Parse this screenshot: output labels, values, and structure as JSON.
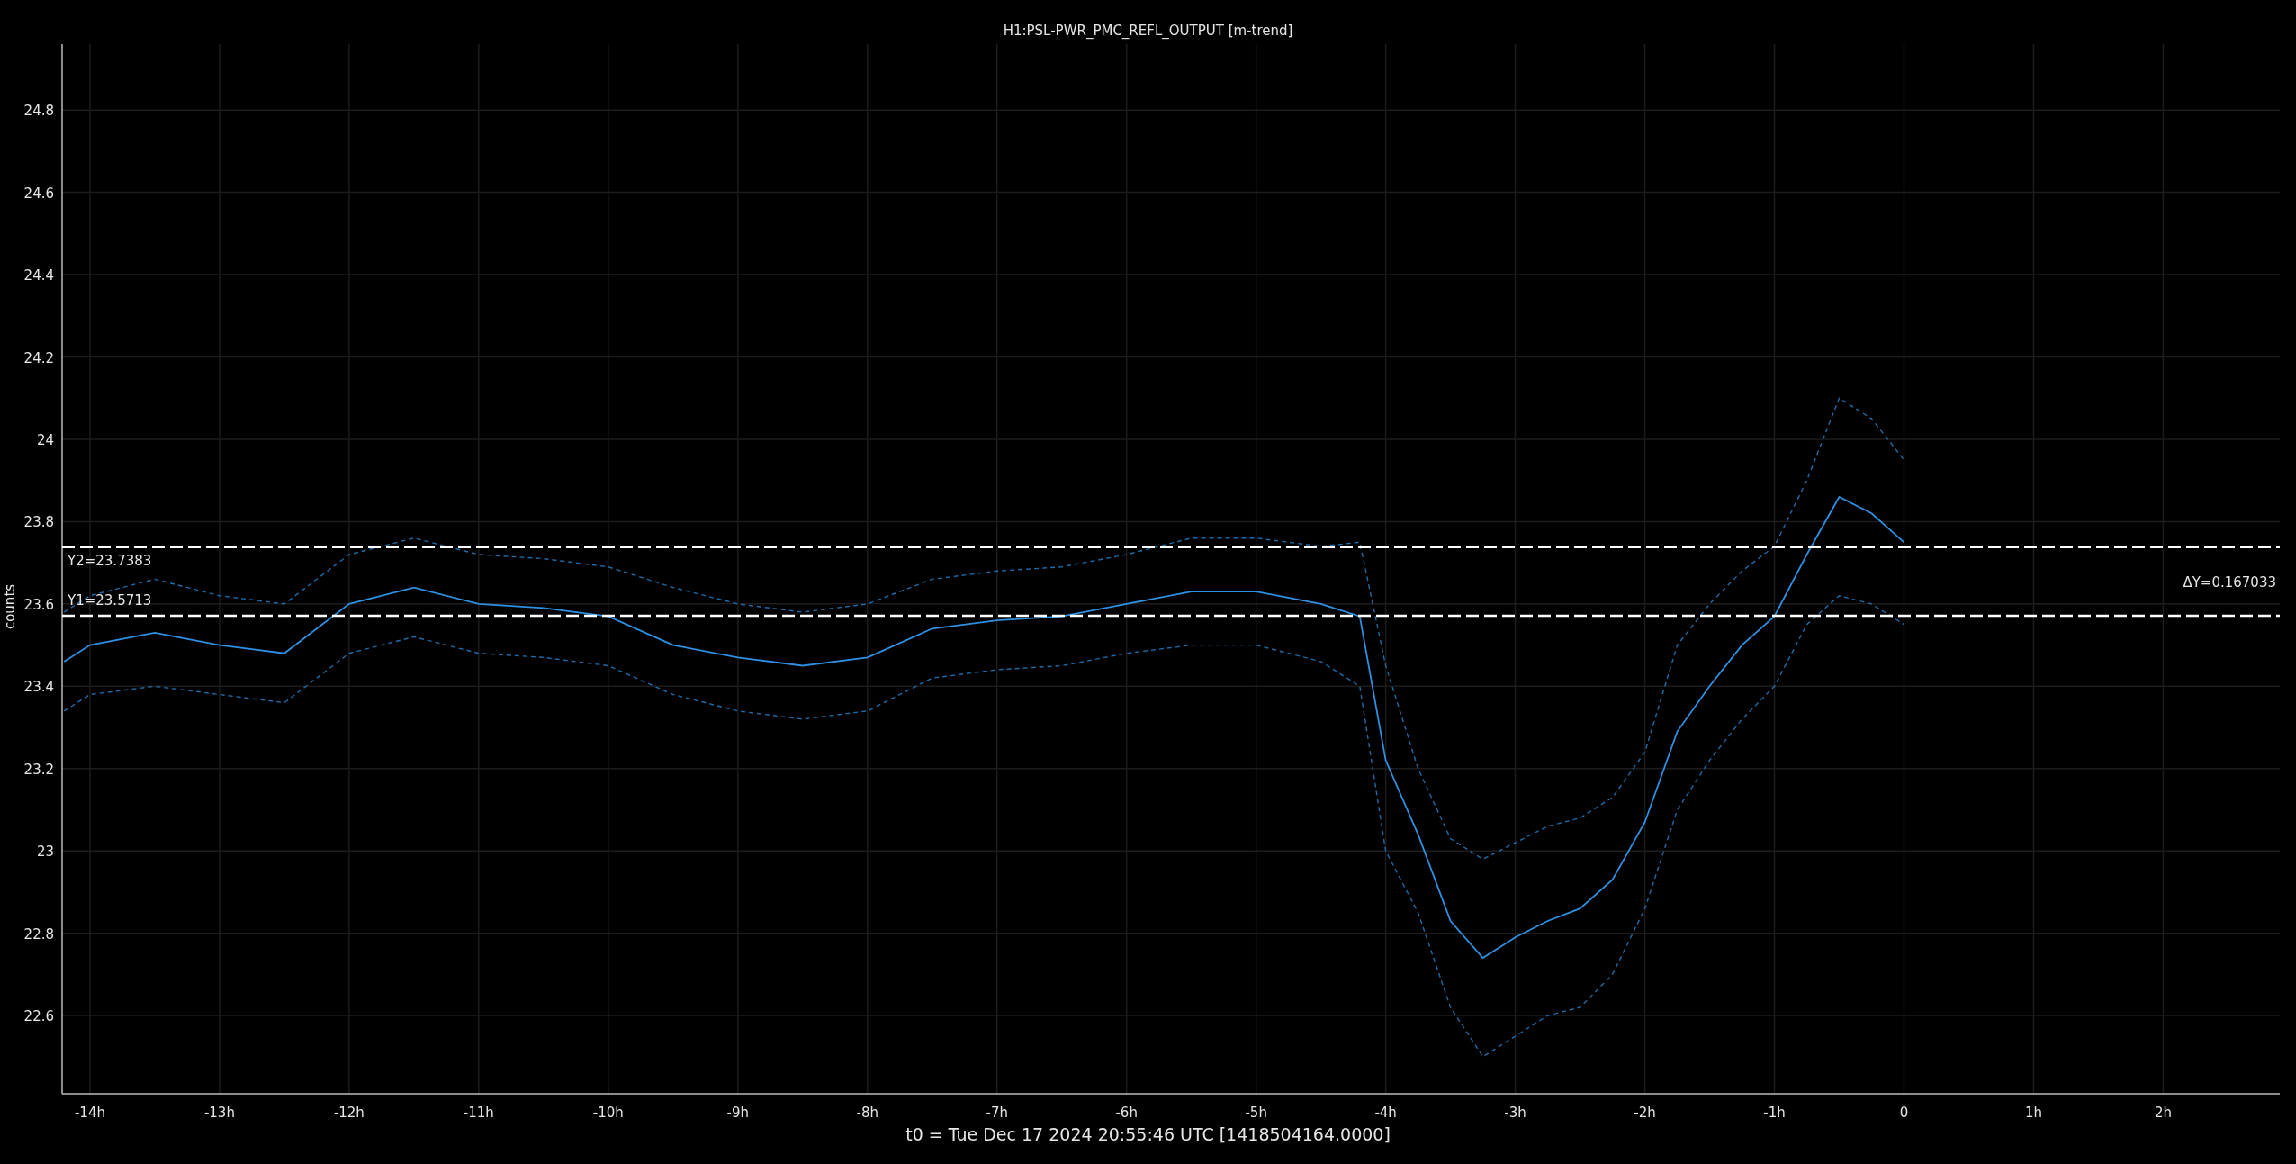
{
  "plot": {
    "title": "H1:PSL-PWR_PMC_REFL_OUTPUT [m-trend]",
    "chart_data": {
      "type": "line",
      "ylabel": "counts",
      "grid": true,
      "xlim": [
        -14.215,
        2.9
      ],
      "ylim": [
        22.41,
        24.96
      ],
      "xticks": [
        {
          "value": -14,
          "label": "-14h"
        },
        {
          "value": -13,
          "label": "-13h"
        },
        {
          "value": -12,
          "label": "-12h"
        },
        {
          "value": -11,
          "label": "-11h"
        },
        {
          "value": -10,
          "label": "-10h"
        },
        {
          "value": -9,
          "label": "-9h"
        },
        {
          "value": -8,
          "label": "-8h"
        },
        {
          "value": -7,
          "label": "-7h"
        },
        {
          "value": -6,
          "label": "-6h"
        },
        {
          "value": -5,
          "label": "-5h"
        },
        {
          "value": -4,
          "label": "-4h"
        },
        {
          "value": -3,
          "label": "-3h"
        },
        {
          "value": -2,
          "label": "-2h"
        },
        {
          "value": -1,
          "label": "-1h"
        },
        {
          "value": 0,
          "label": "0"
        },
        {
          "value": 1,
          "label": "1h"
        },
        {
          "value": 2,
          "label": "2h"
        }
      ],
      "yticks": [
        22.6,
        22.8,
        23,
        23.2,
        23.4,
        23.6,
        23.8,
        24,
        24.2,
        24.4,
        24.6,
        24.8
      ],
      "x": [
        -14.2,
        -14,
        -13.5,
        -13,
        -12.5,
        -12,
        -11.5,
        -11,
        -10.5,
        -10,
        -9.5,
        -9,
        -8.5,
        -8,
        -7.5,
        -7,
        -6.5,
        -6,
        -5.5,
        -5,
        -4.5,
        -4.2,
        -4,
        -3.75,
        -3.5,
        -3.25,
        -3,
        -2.75,
        -2.5,
        -2.25,
        -2,
        -1.75,
        -1.5,
        -1.25,
        -1,
        -0.75,
        -0.5,
        -0.25,
        0
      ],
      "series": [
        {
          "color": "#1f6aa8",
          "line_style": "dashed",
          "values": [
            23.58,
            23.62,
            23.66,
            23.62,
            23.6,
            23.72,
            23.76,
            23.72,
            23.71,
            23.69,
            23.64,
            23.6,
            23.58,
            23.6,
            23.66,
            23.68,
            23.69,
            23.72,
            23.76,
            23.76,
            23.74,
            23.75,
            23.45,
            23.2,
            23.03,
            22.98,
            23.02,
            23.06,
            23.08,
            23.13,
            23.24,
            23.5,
            23.6,
            23.68,
            23.74,
            23.9,
            24.1,
            24.05,
            23.95
          ]
        },
        {
          "color": "#1f6aa8",
          "line_style": "dashed",
          "values": [
            23.34,
            23.38,
            23.4,
            23.38,
            23.36,
            23.48,
            23.52,
            23.48,
            23.47,
            23.45,
            23.38,
            23.34,
            23.32,
            23.34,
            23.42,
            23.44,
            23.45,
            23.48,
            23.5,
            23.5,
            23.46,
            23.4,
            23.0,
            22.85,
            22.62,
            22.5,
            22.55,
            22.6,
            22.62,
            22.7,
            22.86,
            23.1,
            23.22,
            23.32,
            23.4,
            23.55,
            23.62,
            23.6,
            23.55
          ]
        },
        {
          "color": "#2f8fe0",
          "line_style": "solid",
          "values": [
            23.46,
            23.5,
            23.53,
            23.5,
            23.48,
            23.6,
            23.64,
            23.6,
            23.59,
            23.57,
            23.5,
            23.47,
            23.45,
            23.47,
            23.54,
            23.56,
            23.57,
            23.6,
            23.63,
            23.63,
            23.6,
            23.57,
            23.22,
            23.04,
            22.83,
            22.74,
            22.79,
            22.83,
            22.86,
            22.93,
            23.07,
            23.29,
            23.4,
            23.5,
            23.57,
            23.72,
            23.86,
            23.82,
            23.75
          ]
        }
      ],
      "ref_lines": [
        {
          "axis": "y",
          "value": 23.7383,
          "label": "Y2=23.7383",
          "line_style": "dashed",
          "color": "#ffffff"
        },
        {
          "axis": "y",
          "value": 23.5713,
          "label": "Y1=23.5713",
          "line_style": "dashed",
          "color": "#ffffff"
        }
      ]
    },
    "cursor_delta": "ΔY=0.167033"
  },
  "footer": "t0 = Tue Dec 17 2024 20:55:46 UTC [1418504164.0000]"
}
